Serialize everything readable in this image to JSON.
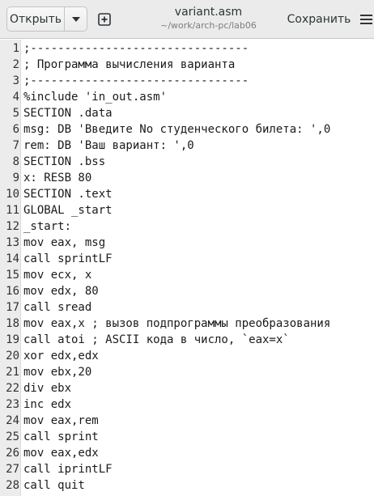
{
  "header": {
    "open_label": "Открыть",
    "title": "variant.asm",
    "subtitle": "~/work/arch-pc/lab06",
    "save_label": "Сохранить",
    "icons": {
      "open_menu": "chevron-down-icon",
      "new_tab": "new-tab-icon",
      "main_menu": "hamburger-menu-icon"
    }
  },
  "editor": {
    "lines": [
      {
        "num": "1",
        "text": ";--------------------------------"
      },
      {
        "num": "2",
        "text": "; Программа вычисления варианта"
      },
      {
        "num": "3",
        "text": ";--------------------------------"
      },
      {
        "num": "4",
        "text": "%include 'in_out.asm'"
      },
      {
        "num": "5",
        "text": "SECTION .data"
      },
      {
        "num": "6",
        "text": "msg: DB 'Введите No студенческого билета: ',0"
      },
      {
        "num": "7",
        "text": "rem: DB 'Ваш вариант: ',0"
      },
      {
        "num": "8",
        "text": "SECTION .bss"
      },
      {
        "num": "9",
        "text": "x: RESB 80"
      },
      {
        "num": "10",
        "text": "SECTION .text"
      },
      {
        "num": "11",
        "text": "GLOBAL _start"
      },
      {
        "num": "12",
        "text": "_start:"
      },
      {
        "num": "13",
        "text": "mov eax, msg"
      },
      {
        "num": "14",
        "text": "call sprintLF"
      },
      {
        "num": "15",
        "text": "mov ecx, x"
      },
      {
        "num": "16",
        "text": "mov edx, 80"
      },
      {
        "num": "17",
        "text": "call sread"
      },
      {
        "num": "18",
        "text": "mov eax,x ; вызов подпрограммы преобразования"
      },
      {
        "num": "19",
        "text": "call atoi ; ASCII кода в число, `eax=x`"
      },
      {
        "num": "20",
        "text": "xor edx,edx"
      },
      {
        "num": "21",
        "text": "mov ebx,20"
      },
      {
        "num": "22",
        "text": "div ebx"
      },
      {
        "num": "23",
        "text": "inc edx"
      },
      {
        "num": "24",
        "text": "mov eax,rem"
      },
      {
        "num": "25",
        "text": "call sprint"
      },
      {
        "num": "26",
        "text": "mov eax,edx"
      },
      {
        "num": "27",
        "text": "call iprintLF"
      },
      {
        "num": "28",
        "text": "call quit"
      }
    ]
  }
}
